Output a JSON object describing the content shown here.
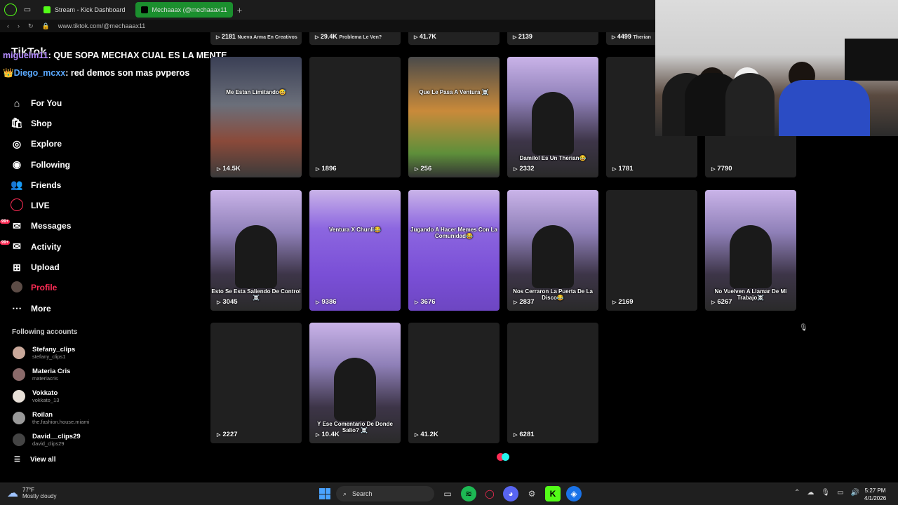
{
  "browser": {
    "tabs": [
      {
        "label": "Stream - Kick Dashboard",
        "favicon_color": "#53fc18"
      },
      {
        "label": "Mechaaax (@mechaaax11",
        "favicon_color": "#000000"
      }
    ],
    "url": "www.tiktok.com/@mechaaax11"
  },
  "brand": {
    "logo": "TikTok",
    "accent": "#fe2c55"
  },
  "chat": [
    {
      "user": "miguelm11",
      "message": ": QUE SOPA MECHAX CUAL ES LA MENTE"
    },
    {
      "user": "Diego_mcxx",
      "message": ": red demos son mas pvperos"
    }
  ],
  "nav": [
    {
      "icon": "home-icon",
      "label": "For You"
    },
    {
      "icon": "shop-icon",
      "label": "Shop"
    },
    {
      "icon": "compass-icon",
      "label": "Explore"
    },
    {
      "icon": "following-icon",
      "label": "Following"
    },
    {
      "icon": "friends-icon",
      "label": "Friends"
    },
    {
      "icon": "live-icon",
      "label": "LIVE"
    },
    {
      "icon": "messages-icon",
      "label": "Messages",
      "badge": "99+"
    },
    {
      "icon": "activity-icon",
      "label": "Activity",
      "badge": "99+"
    },
    {
      "icon": "upload-icon",
      "label": "Upload"
    },
    {
      "icon": "profile-icon",
      "label": "Profile"
    },
    {
      "icon": "more-icon",
      "label": "More"
    }
  ],
  "following_header": "Following accounts",
  "accounts": [
    {
      "name": "Stefany_clips",
      "username": "stefany_clips1"
    },
    {
      "name": "Materia Cris",
      "username": "materiacris"
    },
    {
      "name": "Vokkato",
      "username": "vokkato_13"
    },
    {
      "name": "Roilan",
      "username": "the.fashion.house.miami"
    },
    {
      "name": "David__clips29",
      "username": "david_clips29"
    }
  ],
  "view_all": "View all",
  "top_row_views": [
    "2181",
    "29.4K",
    "41.7K",
    "2139",
    "4499"
  ],
  "top_row_captions": [
    "Nueva Arma En Creativos",
    "Problema Le Ven?",
    "",
    "",
    "Therian"
  ],
  "videos": [
    {
      "views": "14.5K",
      "caption": "Me Estan Limitando😅",
      "style": "room"
    },
    {
      "views": "1896",
      "caption": "",
      "style": "blank"
    },
    {
      "views": "256",
      "caption": "Que Le Pasa A Ventura ☠️",
      "style": "game"
    },
    {
      "views": "2332",
      "caption": "Damilol Es Un Therian😂",
      "style": "thumb"
    },
    {
      "views": "1781",
      "caption": "",
      "style": "blank"
    },
    {
      "views": "7790",
      "caption": "",
      "style": "blank"
    },
    {
      "views": "3045",
      "caption": "Esto Se Esta Saliendo De Control ☠️",
      "style": "thumb"
    },
    {
      "views": "9386",
      "caption": "Ventura X Chunli😂",
      "style": "purple"
    },
    {
      "views": "3676",
      "caption": "Jugando A Hacer Memes Con La Comunidad😂",
      "style": "purple"
    },
    {
      "views": "2837",
      "caption": "Nos Cerraron La Puerta De La Disco😂",
      "style": "thumb"
    },
    {
      "views": "2169",
      "caption": "",
      "style": "blank"
    },
    {
      "views": "6267",
      "caption": "No Vuelven A Llamar De Mi Trabajo☠️",
      "style": "thumb"
    },
    {
      "views": "2227",
      "caption": "",
      "style": "blank"
    },
    {
      "views": "10.4K",
      "caption": "Y Ese Comentario De Donde Salio? ☠️",
      "style": "thumb"
    },
    {
      "views": "41.2K",
      "caption": "",
      "style": "blank"
    },
    {
      "views": "6281",
      "caption": "",
      "style": "blank"
    }
  ],
  "taskbar": {
    "weather_temp": "77°F",
    "weather_desc": "Mostly cloudy",
    "search_label": "Search",
    "time": "5:27 PM",
    "date": "4/1/2026"
  }
}
